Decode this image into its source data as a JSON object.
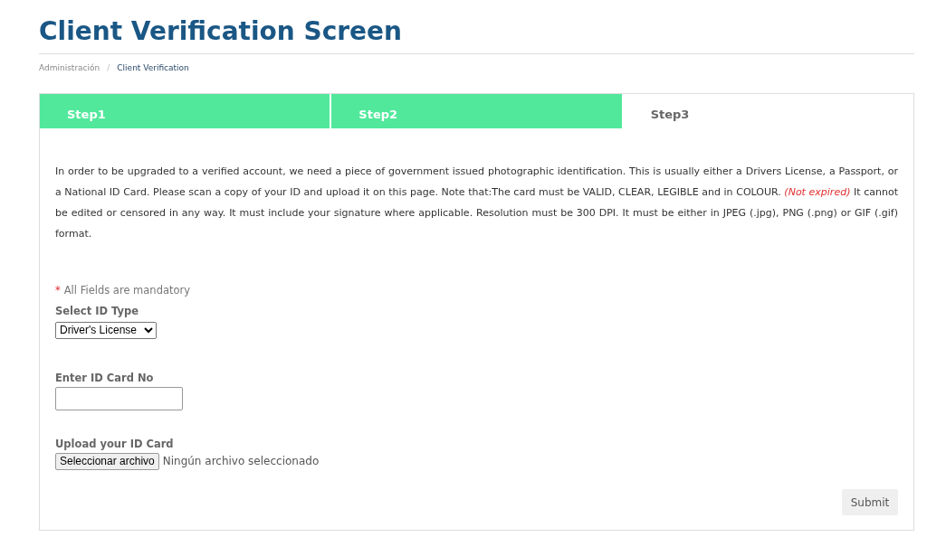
{
  "title": "Client Verification Screen",
  "breadcrumb_separator": "/",
  "breadcrumb": [
    {
      "label": "Administración",
      "current": false
    },
    {
      "label": "Client Verification",
      "current": true
    }
  ],
  "steps": [
    {
      "label": "Step1",
      "selected": false
    },
    {
      "label": "Step2",
      "selected": false
    },
    {
      "label": "Step3",
      "selected": true
    }
  ],
  "intro": "In order to be upgraded to a verified account, we need a piece of government issued photographic identification. This is usually either a Drivers License, a Passport, or a National ID Card. Please scan a copy of your ID and upload it on this page. Note that:The card must be VALID, CLEAR, LEGIBLE and in COLOUR. *(Not expired)* It cannot be edited or censored in any way. It must include your signature where applicable. Resolution must be 300 DPI. It must be either in JPEG (.jpg), PNG (.png) or GIF (.gif) format.",
  "mandatory_note": {
    "mark": "*",
    "text": "All Fields are mandatory"
  },
  "id_type": {
    "label": "Select ID Type",
    "value": "Driver's License"
  },
  "id_number": {
    "label": "Enter ID Card No"
  },
  "upload": {
    "label": "Upload your ID Card",
    "button": "Seleccionar archivo",
    "status": "Ningún archivo seleccionado"
  },
  "submit": "Submit"
}
